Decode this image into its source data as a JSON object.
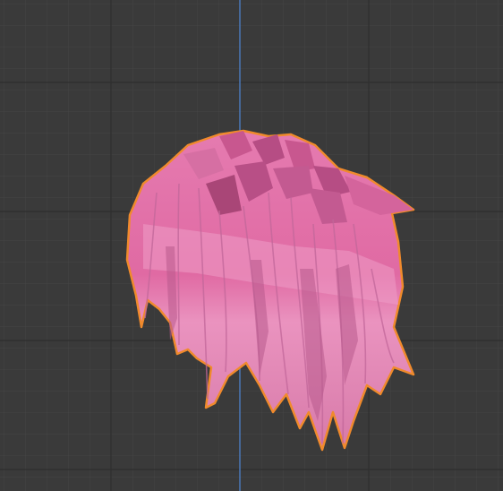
{
  "viewport": {
    "background": "#3a3a3a",
    "grid_minor_color": "#434343",
    "grid_major_color": "#2e2e2e",
    "y_axis_color": "#4a77b8",
    "selection_outline_color": "#f08a2c"
  },
  "object": {
    "name_icon": "hair-mesh",
    "base_color": "#e07aad",
    "highlight_color": "#f0a0c8",
    "shadow_color": "#b84f86",
    "selected": true
  }
}
